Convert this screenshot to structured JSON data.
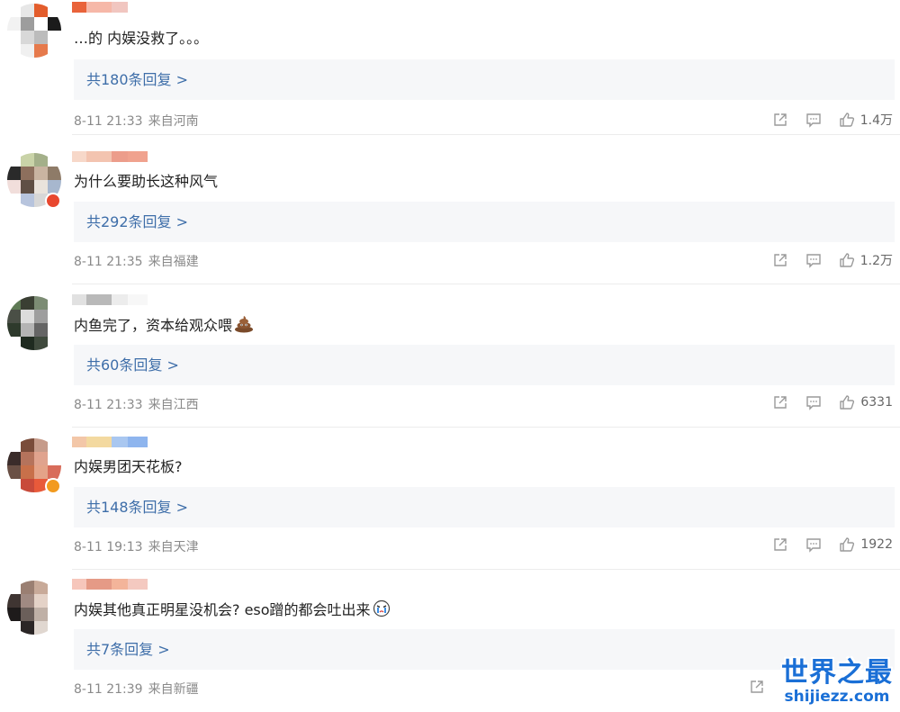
{
  "comments": [
    {
      "text": "…的 内娱没救了。。。",
      "replies_label": "共180条回复 >",
      "time": "8-11 21:33",
      "location": "来自河南",
      "likes": "1.4万",
      "avatar_colors": [
        "#ffffff",
        "#e7e7e7",
        "#e35d2c",
        "#ffffff",
        "#f2f2f2",
        "#9d9d9d",
        "#ffffff",
        "#1b1b1b",
        "#ffffff",
        "#d8d8d8",
        "#bcbcbc",
        "#ffffff",
        "#ffffff",
        "#f0f0f0",
        "#e67a4c",
        "#ffffff"
      ],
      "name_colors": [
        "#e9633a",
        "#f6b8a8",
        "#f1c6c0",
        "#ffffff"
      ],
      "badge": false,
      "emoji": ""
    },
    {
      "text": "为什么要助长这种风气",
      "replies_label": "共292条回复 >",
      "time": "8-11 21:35",
      "location": "来自福建",
      "likes": "1.2万",
      "avatar_colors": [
        "#ffffff",
        "#c9d3a8",
        "#a4b08a",
        "#ffffff",
        "#2a2a2a",
        "#8d6f5d",
        "#c9b4a1",
        "#8e7b68",
        "#f1dedb",
        "#5f4f45",
        "#e9e3dc",
        "#a7b7ce",
        "#ffffff",
        "#b7c4dd",
        "#d7d7d7",
        "#ffffff"
      ],
      "name_colors": [
        "#f7d8c9",
        "#f3c4b0",
        "#ec9d8b",
        "#f0a28e"
      ],
      "badge": true,
      "emoji": ""
    },
    {
      "text": "内鱼完了，资本给观众喂",
      "replies_label": "共60条回复 >",
      "time": "8-11 21:33",
      "location": "来自江西",
      "likes": "6331",
      "avatar_colors": [
        "#5f7a55",
        "#3a3f33",
        "#7c8c74",
        "#ffffff",
        "#4a4f46",
        "#dcdcdc",
        "#9e9e9e",
        "#ffffff",
        "#2e3a2c",
        "#b4b4b4",
        "#656565",
        "#ffffff",
        "#ffffff",
        "#1f2b20",
        "#3f4a3d",
        "#ffffff"
      ],
      "name_colors": [
        "#e1e1e1",
        "#b9b9b9",
        "#ececec",
        "#f7f7f7"
      ],
      "badge": false,
      "emoji": "poop"
    },
    {
      "text": "内娱男团天花板?",
      "replies_label": "共148条回复 >",
      "time": "8-11 19:13",
      "location": "来自天津",
      "likes": "1922",
      "avatar_colors": [
        "#ffffff",
        "#7a4c3a",
        "#c69b8a",
        "#ffffff",
        "#3a2c2a",
        "#b5735c",
        "#e0a38e",
        "#ffffff",
        "#6a5045",
        "#c8704a",
        "#e4a388",
        "#d86c5a",
        "#ffffff",
        "#c84a3a",
        "#e85a3a",
        "#ffffff"
      ],
      "name_colors": [
        "#f3c7a8",
        "#f3d9a0",
        "#a9c7f0",
        "#8eb5ee"
      ],
      "badge": true,
      "emoji": ""
    },
    {
      "text": "内娱其他真正明星没机会? eso蹭的都会吐出来",
      "replies_label": "共7条回复 >",
      "time": "8-11 21:39",
      "location": "来自新疆",
      "likes": "",
      "avatar_colors": [
        "#ffffff",
        "#9a7f72",
        "#c8aa99",
        "#ffffff",
        "#3f3532",
        "#a08a82",
        "#e4d2c7",
        "#ffffff",
        "#1e1b1b",
        "#6b5f5a",
        "#bfb0a6",
        "#ffffff",
        "#ffffff",
        "#2b2626",
        "#e0d7d0",
        "#ffffff"
      ],
      "name_colors": [
        "#f6c6bb",
        "#e59a86",
        "#f3b49a",
        "#f4c9c0"
      ],
      "badge": false,
      "emoji": "crying"
    }
  ],
  "icons": {
    "share": "share-icon",
    "comment": "comment-icon",
    "like": "thumbs-up-icon"
  },
  "watermark": {
    "title": "世界之最",
    "url": "shijiezz.com"
  },
  "colors": {
    "link": "#3e6ea9",
    "reply_bg": "#f6f7f9",
    "meta": "#8a8a8a",
    "watermark": "#1a6fd6"
  }
}
